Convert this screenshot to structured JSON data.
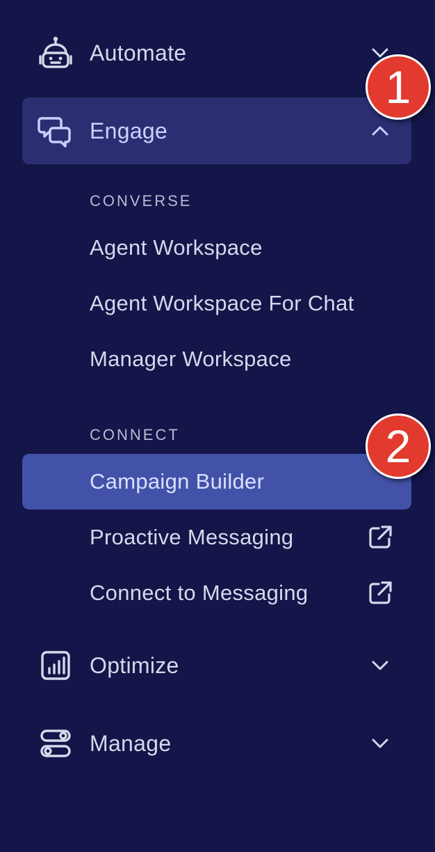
{
  "nav": {
    "automate": {
      "label": "Automate",
      "icon": "robot-icon",
      "expanded": false
    },
    "engage": {
      "label": "Engage",
      "icon": "chat-bubbles-icon",
      "expanded": true
    },
    "optimize": {
      "label": "Optimize",
      "icon": "bar-chart-icon",
      "expanded": false
    },
    "manage": {
      "label": "Manage",
      "icon": "toggles-icon",
      "expanded": false
    }
  },
  "engage_sections": {
    "converse": {
      "heading": "CONVERSE",
      "items": [
        {
          "label": "Agent Workspace"
        },
        {
          "label": "Agent Workspace For Chat"
        },
        {
          "label": "Manager Workspace"
        }
      ]
    },
    "connect": {
      "heading": "CONNECT",
      "items": [
        {
          "label": "Campaign Builder",
          "selected": true
        },
        {
          "label": "Proactive Messaging",
          "external": true
        },
        {
          "label": "Connect to Messaging",
          "external": true
        }
      ]
    }
  },
  "annotations": [
    {
      "number": "1"
    },
    {
      "number": "2"
    }
  ],
  "colors": {
    "background": "#141548",
    "active_group": "#2b2f72",
    "selected_item": "#4252a8",
    "badge": "#e23a2e"
  }
}
